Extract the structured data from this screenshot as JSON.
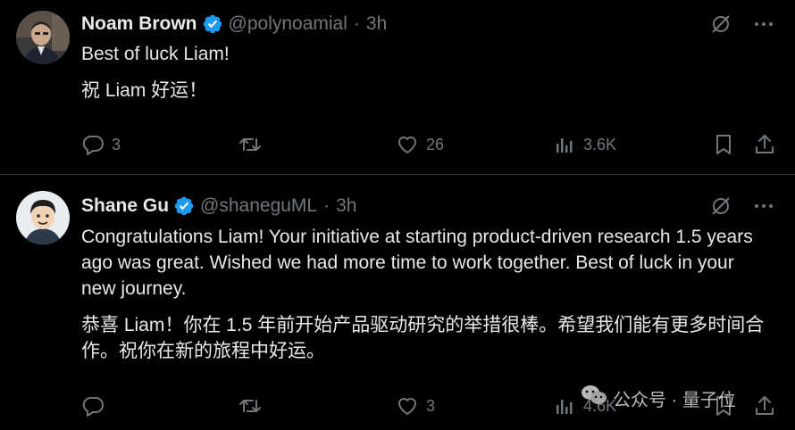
{
  "colors": {
    "background": "#000000",
    "text_primary": "#e7e9ea",
    "text_secondary": "#71767b",
    "verified_badge": "#1d9bf0",
    "divider": "#2f3336"
  },
  "tweets": [
    {
      "author": {
        "name": "Noam Brown",
        "handle": "@polynoamial",
        "verified_icon": "verified-badge-icon",
        "avatar_icon": "avatar-photo"
      },
      "separator": "·",
      "time": "3h",
      "text": [
        "Best of luck Liam!",
        "祝 Liam 好运！"
      ],
      "actions": {
        "reply_count": "3",
        "retweet_count": "",
        "like_count": "26",
        "view_count": "3.6K"
      }
    },
    {
      "author": {
        "name": "Shane Gu",
        "handle": "@shaneguML",
        "verified_icon": "verified-badge-icon",
        "avatar_icon": "avatar-cartoon"
      },
      "separator": "·",
      "time": "3h",
      "text": [
        "Congratulations Liam! Your initiative at starting product-driven research 1.5 years ago was great. Wished we had more time to work together. Best of luck in your new journey.",
        "恭喜 Liam！你在 1.5 年前开始产品驱动研究的举措很棒。希望我们能有更多时间合作。祝你在新的旅程中好运。"
      ],
      "actions": {
        "reply_count": "",
        "retweet_count": "",
        "like_count": "3",
        "view_count": "4.6K"
      }
    }
  ],
  "watermark": {
    "text": "公众号 · 量子位",
    "icon": "wechat-icon"
  }
}
